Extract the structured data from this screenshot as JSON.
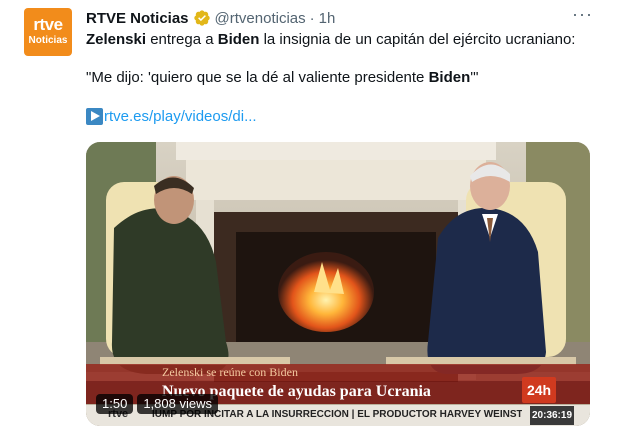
{
  "account": {
    "avatar_line1": "rtve",
    "avatar_line2": "Noticias",
    "name": "RTVE Noticias",
    "handle": "@rtvenoticias",
    "separator": "·",
    "time": "1h"
  },
  "more_label": "···",
  "tweet": {
    "line1_bold": "Zelenski",
    "line1_a": " entrega a ",
    "line1_bold2": "Biden",
    "line1_b": " la insignia de un capitán del ejército ucraniano:",
    "line2_a": "\"Me dijo: 'quiero que se la dé al valiente presidente ",
    "line2_bold": "Biden",
    "line2_b": "'\"",
    "link": "rtve.es/play/videos/di..."
  },
  "video": {
    "lower_third_small": "Zelenski se reúne con Biden",
    "lower_third_big": "Nuevo paquete de ayudas para Ucrania",
    "channel_badge": "24h",
    "ticker_logo": "rtve",
    "ticker_text": "IUMP POR INCITAR A LA INSURRECCIÓN  |  EL PRODUCTOR HARVEY WEINSTEIN, I",
    "ticker_time": "20:36:19",
    "duration": "1:50",
    "views": "1,808 views"
  },
  "colors": {
    "avatar_bg": "#f28c1b",
    "link": "#1d9bf0",
    "verified": "#e2b719",
    "lower_third": "#96281e",
    "badge": "#d03a1f"
  }
}
